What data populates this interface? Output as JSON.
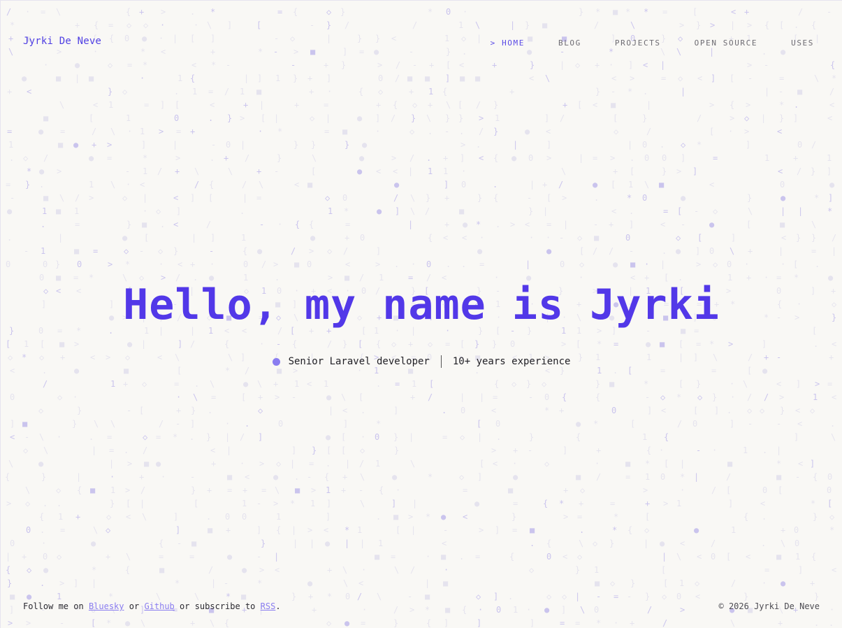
{
  "header": {
    "logo": "Jyrki De Neve",
    "nav": [
      {
        "label": "> HOME",
        "active": true
      },
      {
        "label": "BLOG",
        "active": false
      },
      {
        "label": "PROJECTS",
        "active": false
      },
      {
        "label": "OPEN SOURCE",
        "active": false
      },
      {
        "label": "USES",
        "active": false
      }
    ]
  },
  "hero": {
    "title": "Hello, my name is Jyrki",
    "role": "Senior Laravel developer",
    "experience": "10+ years experience"
  },
  "footer": {
    "follow_prefix": "Follow me on",
    "bluesky": "Bluesky",
    "or": "or",
    "github": "Github",
    "subscribe": "or subscribe to",
    "rss": "RSS",
    "period": ".",
    "copyright": "© 2026 Jyrki De Neve"
  },
  "colors": {
    "accent": "#5238e8",
    "link": "#8a7df0",
    "background": "#f9f8f5"
  }
}
